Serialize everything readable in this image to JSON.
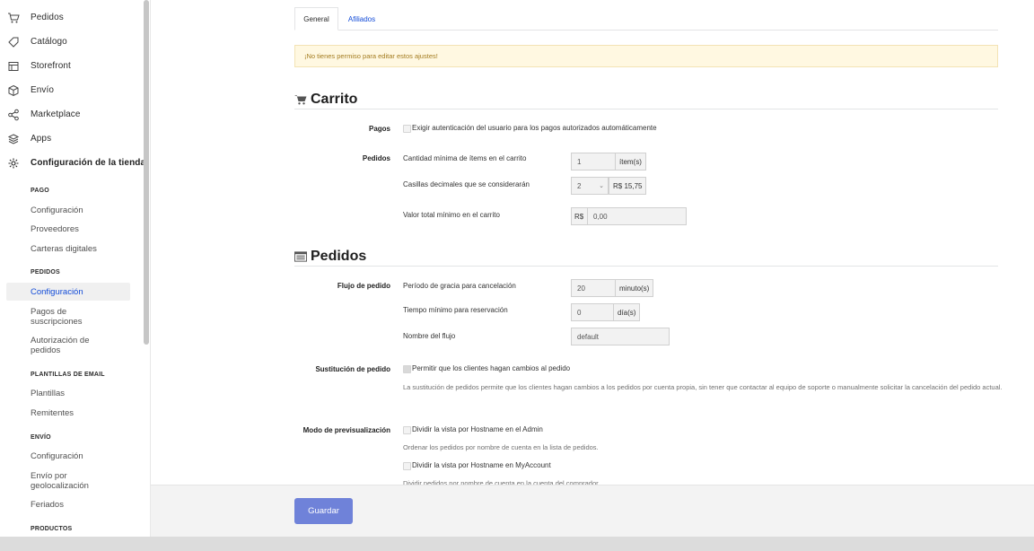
{
  "sidebar": {
    "nav": [
      {
        "label": "Pedidos",
        "icon": "cart-icon"
      },
      {
        "label": "Catálogo",
        "icon": "tag-icon"
      },
      {
        "label": "Storefront",
        "icon": "layout-icon"
      },
      {
        "label": "Envío",
        "icon": "box-icon"
      },
      {
        "label": "Marketplace",
        "icon": "share-icon"
      },
      {
        "label": "Apps",
        "icon": "layers-icon"
      },
      {
        "label": "Configuración de la tienda",
        "icon": "gear-icon"
      }
    ],
    "sections": [
      {
        "title": "PAGO",
        "items": [
          "Configuración",
          "Proveedores",
          "Carteras digitales"
        ]
      },
      {
        "title": "PEDIDOS",
        "items": [
          "Configuración",
          "Pagos de suscripciones",
          "Autorización de pedidos"
        ]
      },
      {
        "title": "PLANTILLAS DE EMAIL",
        "items": [
          "Plantillas",
          "Remitentes"
        ]
      },
      {
        "title": "ENVÍO",
        "items": [
          "Configuración",
          "Envío por geolocalización",
          "Feriados"
        ]
      },
      {
        "title": "PRODUCTOS",
        "items": []
      }
    ],
    "active_item": "Configuración"
  },
  "tabs": [
    "General",
    "Afiliados"
  ],
  "active_tab": "General",
  "warning": "¡No tienes permiso para editar estos ajustes!",
  "carrito": {
    "title": "Carrito",
    "pagos_label": "Pagos",
    "pagos_checkbox": "Exigir autenticación del usuario para los pagos autorizados automáticamente",
    "pedidos_label": "Pedidos",
    "min_items_label": "Cantidad mínima de ítems en el carrito",
    "min_items_value": "1",
    "min_items_suffix": "ítem(s)",
    "decimals_label": "Casillas decimales que se considerarán",
    "decimals_value": "2",
    "decimals_preview": "R$ 15,75",
    "min_total_label": "Valor total mínimo en el carrito",
    "min_total_prefix": "R$",
    "min_total_value": "0,00"
  },
  "pedidos": {
    "title": "Pedidos",
    "flujo_label": "Flujo de pedido",
    "grace_label": "Período de gracia para cancelación",
    "grace_value": "20",
    "grace_suffix": "minuto(s)",
    "reservation_label": "Tiempo mínimo para reservación",
    "reservation_value": "0",
    "reservation_suffix": "día(s)",
    "flow_name_label": "Nombre del flujo",
    "flow_name_value": "default",
    "sustitucion_label": "Sustitución de pedido",
    "sustitucion_checkbox": "Permitir que los clientes hagan cambios al pedido",
    "sustitucion_hint": "La sustitución de pedidos permite que los clientes hagan cambios a los pedidos por cuenta propia, sin tener que contactar al equipo de soporte o manualmente solicitar la cancelación del pedido actual.",
    "preview_label": "Modo de previsualización",
    "preview_admin_checkbox": "Dividir la vista por Hostname en el Admin",
    "preview_admin_hint": "Ordenar los pedidos por nombre de cuenta en la lista de pedidos.",
    "preview_myaccount_checkbox": "Dividir la vista por Hostname en MyAccount",
    "preview_myaccount_hint": "Dividir pedidos por nombre de cuenta en la cuenta del comprador."
  },
  "footer": {
    "save_label": "Guardar"
  }
}
